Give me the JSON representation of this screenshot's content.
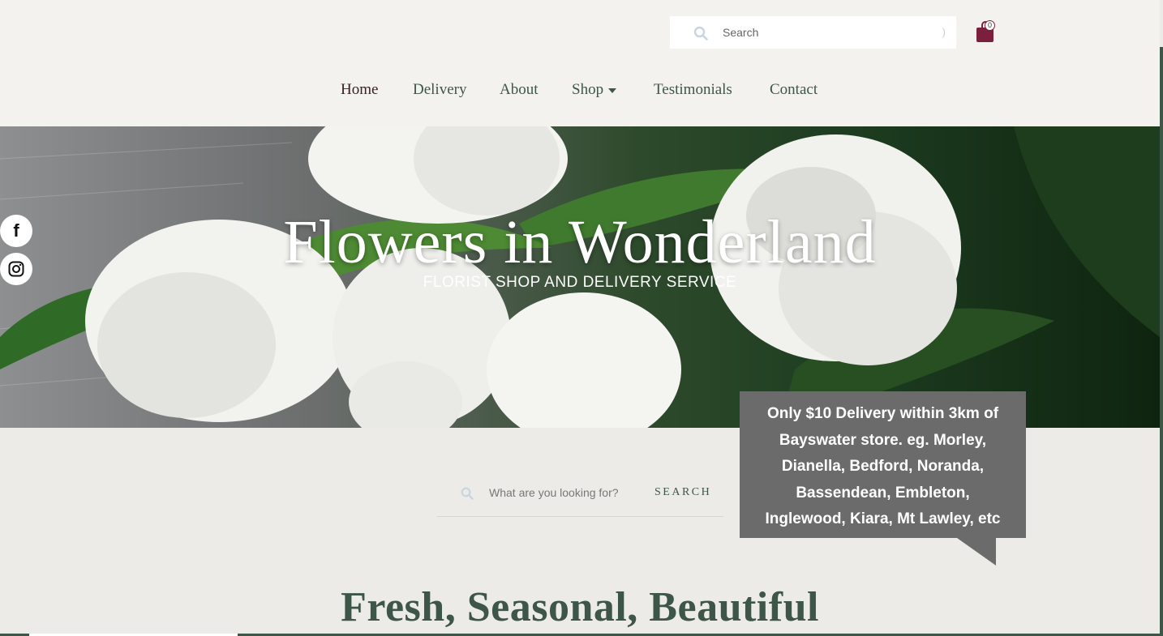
{
  "header": {
    "search_placeholder": "Search",
    "search_end_glyph": ")",
    "cart_count": "0"
  },
  "nav": {
    "items": [
      {
        "label": "Home",
        "active": true
      },
      {
        "label": "Delivery",
        "active": false
      },
      {
        "label": "About",
        "active": false
      },
      {
        "label": "Shop",
        "active": false,
        "has_dropdown": true
      },
      {
        "label": "Testimonials",
        "active": false
      },
      {
        "label": "Contact",
        "active": false
      }
    ]
  },
  "hero": {
    "title": "Flowers in Wonderland",
    "subtitle": "FLORIST SHOP AND DELIVERY SERVICE"
  },
  "social": {
    "facebook_glyph": "f",
    "instagram_icon": "instagram-icon"
  },
  "callout": {
    "lines": [
      "Only $10 Delivery within 3km of",
      "Bayswater store. eg. Morley,",
      "Dianella, Bedford, Noranda,",
      "Bassendean, Embleton,",
      "Inglewood, Kiara, Mt Lawley, etc"
    ]
  },
  "product_search": {
    "placeholder": "What are you looking for?",
    "button_label": "SEARCH"
  },
  "section": {
    "title": "Fresh, Seasonal, Beautiful"
  },
  "colors": {
    "brand_green": "#3d5647",
    "cart_maroon": "#7a1f3d",
    "callout_grey": "#6b6b6b",
    "page_bg": "#ecebe7"
  }
}
